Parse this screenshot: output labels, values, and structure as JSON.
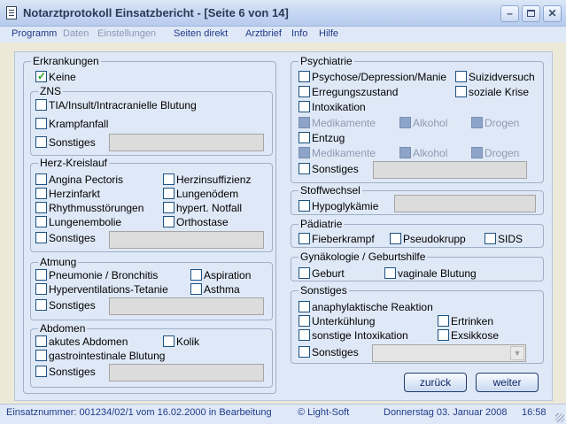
{
  "window": {
    "title": "Notarztprotokoll Einsatzbericht - [Seite 6 von 14]",
    "btn_min": "–"
  },
  "menu": [
    "Programm",
    "Daten",
    "Einstellungen",
    "Seiten direkt",
    "Arztbrief",
    "Info",
    "Hilfe"
  ],
  "sections": {
    "erkrankungen": {
      "title": "Erkrankungen",
      "keine": "Keine",
      "zns": {
        "title": "ZNS",
        "items": [
          "TIA/Insult/Intracranielle Blutung",
          "Krampfanfall",
          "Sonstiges"
        ]
      },
      "herz": {
        "title": "Herz-Kreislauf",
        "items": [
          "Angina Pectoris",
          "Herzinsuffizienz",
          "Herzinfarkt",
          "Lungenödem",
          "Rhythmusstörungen",
          "hypert. Notfall",
          "Lungenembolie",
          "Orthostase",
          "Sonstiges"
        ]
      },
      "atmung": {
        "title": "Atmung",
        "items": [
          "Pneumonie / Bronchitis",
          "Aspiration",
          "Hyperventilations-Tetanie",
          "Asthma",
          "Sonstiges"
        ]
      },
      "abdomen": {
        "title": "Abdomen",
        "items": [
          "akutes Abdomen",
          "Kolik",
          "gastrointestinale Blutung",
          "Sonstiges"
        ]
      }
    },
    "psychiatrie": {
      "title": "Psychiatrie",
      "items": [
        "Psychose/Depression/Manie",
        "Suizidversuch",
        "Erregungszustand",
        "soziale Krise",
        "Intoxikation",
        "Medikamente",
        "Alkohol",
        "Drogen",
        "Entzug",
        "Medikamente",
        "Alkohol",
        "Drogen",
        "Sonstiges"
      ]
    },
    "stoffwechsel": {
      "title": "Stoffwechsel",
      "items": [
        "Hypoglykämie"
      ]
    },
    "paediatrie": {
      "title": "Pädiatrie",
      "items": [
        "Fieberkrampf",
        "Pseudokrupp",
        "SIDS"
      ]
    },
    "gyn": {
      "title": "Gynäkologie / Geburtshilfe",
      "items": [
        "Geburt",
        "vaginale Blutung"
      ]
    },
    "sonstiges": {
      "title": "Sonstiges",
      "items": [
        "anaphylaktische Reaktion",
        "Unterkühlung",
        "Ertrinken",
        "sonstige Intoxikation",
        "Exsikkose",
        "Sonstiges"
      ]
    }
  },
  "buttons": {
    "back": "zurück",
    "next": "weiter"
  },
  "status": {
    "left": "Einsatznummer: 001234/02/1 vom 16.02.2000 in Bearbeitung",
    "middle": "© Light-Soft",
    "date": "Donnerstag  03.  Januar  2008",
    "time": "16:58"
  }
}
